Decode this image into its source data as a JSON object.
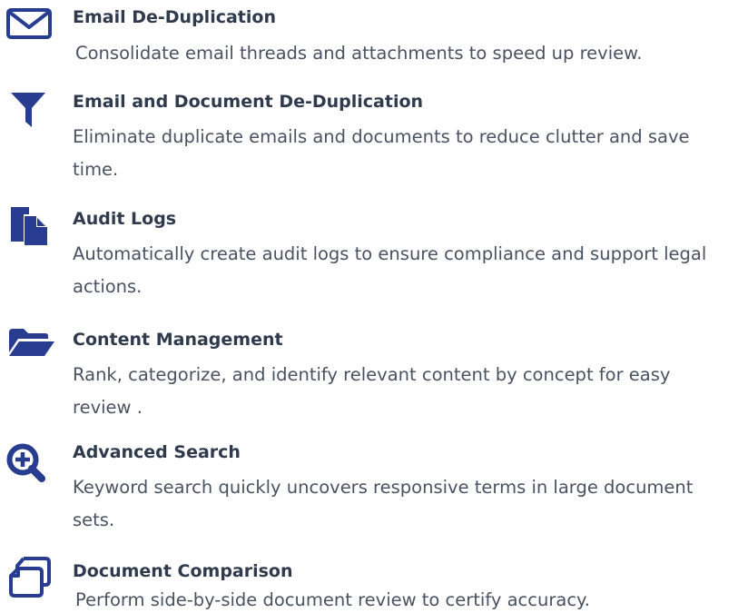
{
  "features": [
    {
      "icon": "envelope-icon",
      "title": "Email De-Duplication",
      "description": "Consolidate email threads and attachments to speed up review."
    },
    {
      "icon": "funnel-icon",
      "title": "Email and Document De-Duplication",
      "description": "Eliminate duplicate emails and documents to reduce clutter and save time."
    },
    {
      "icon": "copy-files-icon",
      "title": "Audit Logs",
      "description": "Automatically create audit logs to ensure compliance and support legal actions."
    },
    {
      "icon": "folder-open-icon",
      "title": "Content Management",
      "description": "Rank, categorize, and identify relevant content by concept for easy review ."
    },
    {
      "icon": "zoom-in-icon",
      "title": "Advanced Search",
      "description": "Keyword search quickly uncovers responsive terms in large document sets."
    },
    {
      "icon": "compare-documents-icon",
      "title": "Document Comparison",
      "description": "Perform side-by-side document review to certify accuracy."
    }
  ],
  "colors": {
    "icon": "#283d8f",
    "title": "#2f3a4d",
    "text": "#4a5261"
  }
}
